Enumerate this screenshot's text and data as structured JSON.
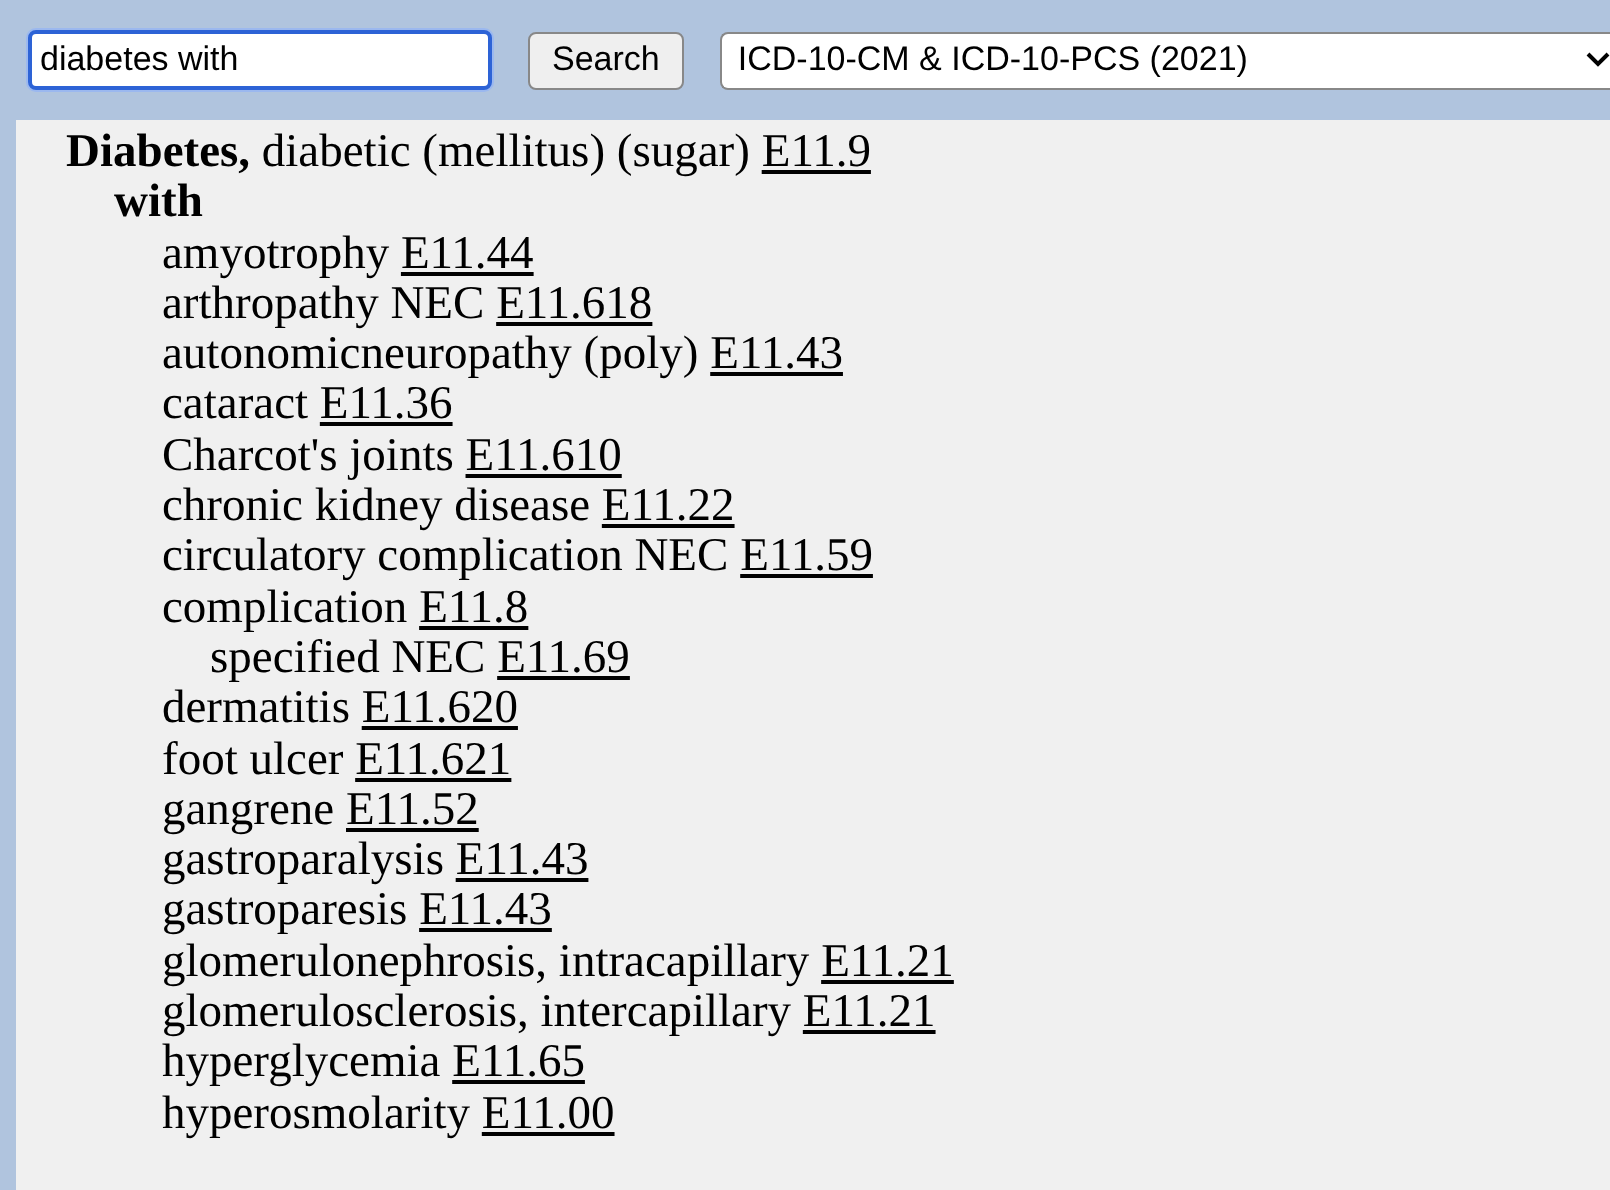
{
  "search": {
    "value": "diabetes with",
    "button": "Search",
    "edition": "ICD-10-CM & ICD-10-PCS (2021)"
  },
  "index_entry": {
    "term": "Diabetes,",
    "description": "diabetic (mellitus) (sugar)",
    "code": "E11.9",
    "children": [
      {
        "label": "with",
        "children": [
          {
            "label": "amyotrophy",
            "code": "E11.44"
          },
          {
            "label": "arthropathy NEC",
            "code": "E11.618"
          },
          {
            "label": "autonomicneuropathy (poly)",
            "code": "E11.43"
          },
          {
            "label": "cataract",
            "code": "E11.36"
          },
          {
            "label": "Charcot's joints",
            "code": "E11.610"
          },
          {
            "label": "chronic kidney disease",
            "code": "E11.22"
          },
          {
            "label": "circulatory complication NEC",
            "code": "E11.59"
          },
          {
            "label": "complication",
            "code": "E11.8",
            "children": [
              {
                "label": "specified NEC",
                "code": "E11.69"
              }
            ]
          },
          {
            "label": "dermatitis",
            "code": "E11.620"
          },
          {
            "label": "foot ulcer",
            "code": "E11.621"
          },
          {
            "label": "gangrene",
            "code": "E11.52"
          },
          {
            "label": "gastroparalysis",
            "code": "E11.43"
          },
          {
            "label": "gastroparesis",
            "code": "E11.43"
          },
          {
            "label": "glomerulonephrosis, intracapillary",
            "code": "E11.21"
          },
          {
            "label": "glomerulosclerosis, intercapillary",
            "code": "E11.21"
          },
          {
            "label": "hyperglycemia",
            "code": "E11.65"
          },
          {
            "label": "hyperosmolarity",
            "code": "E11.00"
          }
        ]
      }
    ]
  }
}
